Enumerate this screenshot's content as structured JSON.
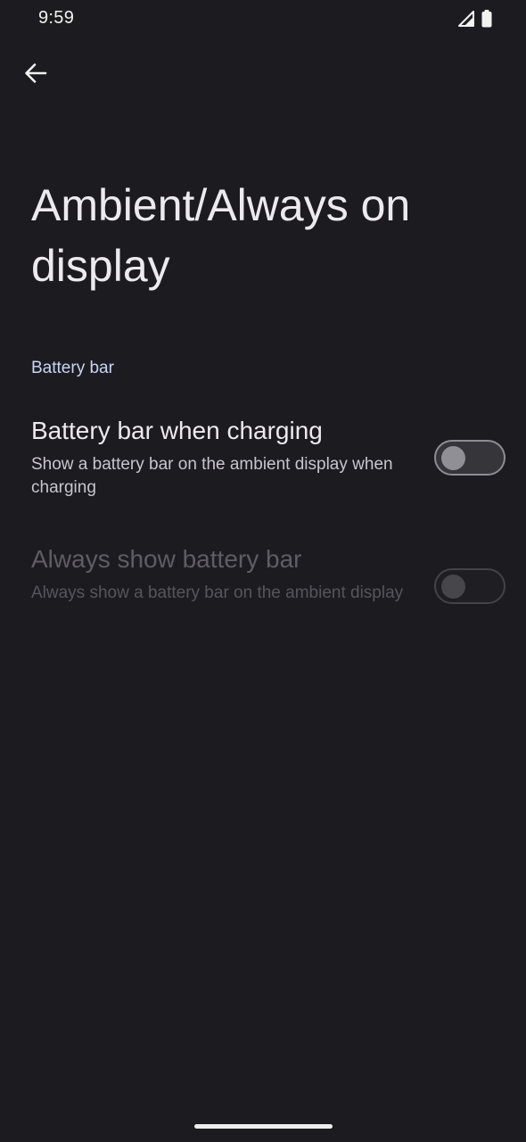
{
  "status_bar": {
    "time": "9:59",
    "icons": [
      "cellular-signal-icon",
      "battery-icon"
    ]
  },
  "app_bar": {
    "back_icon": "arrow-back-icon"
  },
  "page": {
    "title": "Ambient/Always on display"
  },
  "section": {
    "header": "Battery bar"
  },
  "preferences": [
    {
      "title": "Battery bar when charging",
      "summary": "Show a battery bar on the ambient display when charging",
      "enabled": true,
      "checked": false
    },
    {
      "title": "Always show battery bar",
      "summary": "Always show a battery bar on the ambient display",
      "enabled": false,
      "checked": false
    }
  ],
  "colors": {
    "background": "#1c1c20",
    "section_header": "#c9d4f6",
    "text_primary": "#ece9ef",
    "text_secondary": "#c8c5cc",
    "text_disabled": "#5f5d63"
  }
}
